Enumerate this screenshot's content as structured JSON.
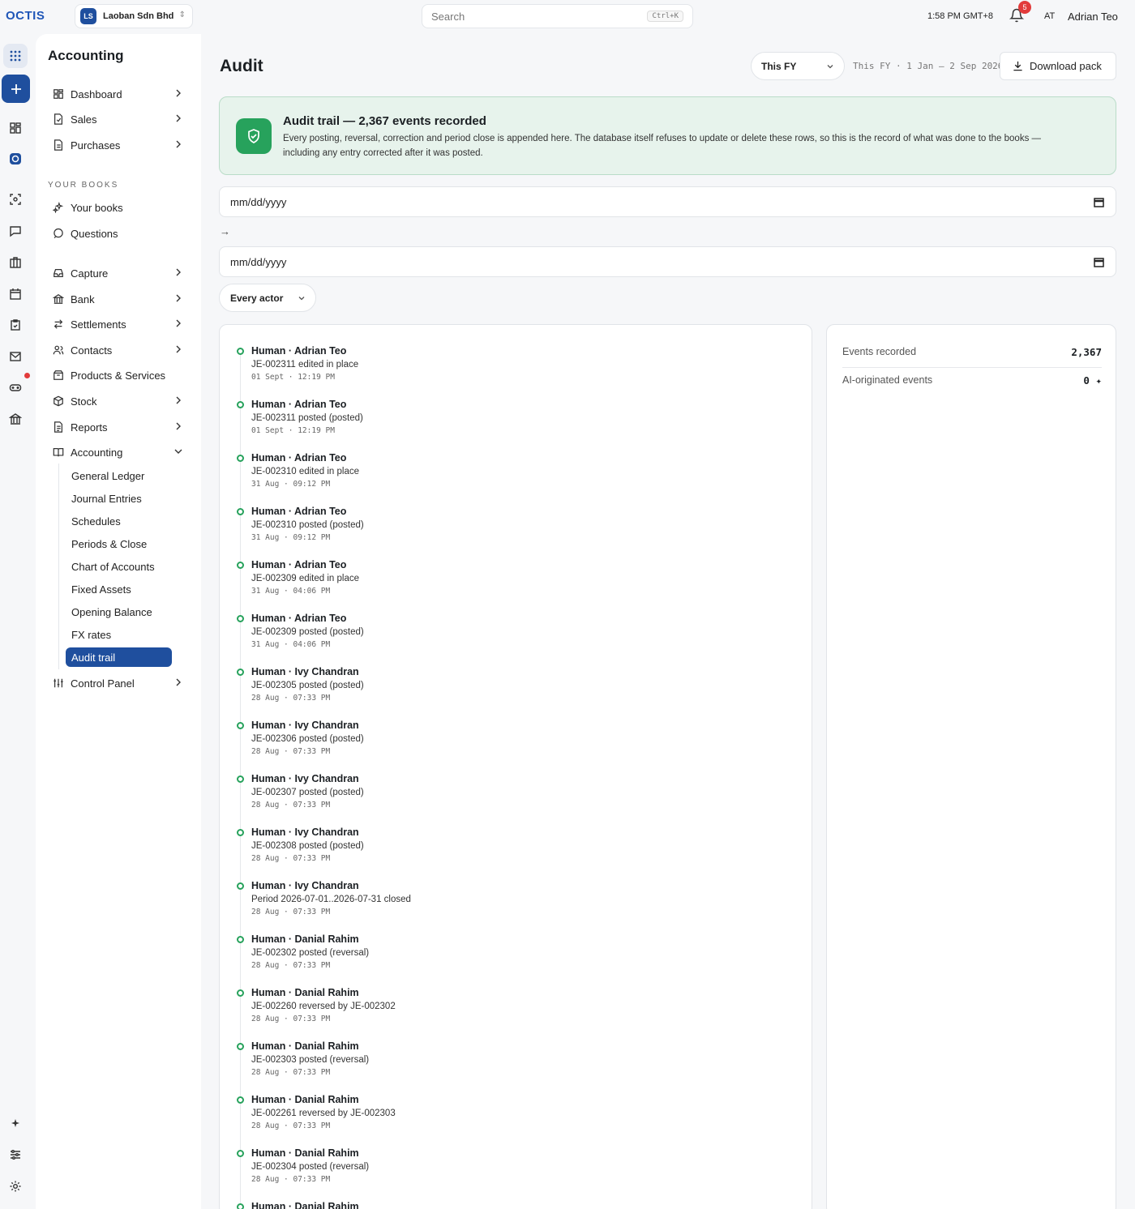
{
  "app": {
    "logo_text": "OCTIS",
    "org": {
      "initials": "LS",
      "name": "Laoban Sdn Bhd"
    },
    "search": {
      "placeholder": "Search",
      "shortcut": "Ctrl+K"
    },
    "clock": "1:58 PM GMT+8",
    "notifications_count": "5",
    "user": {
      "initials": "AT",
      "name": "Adrian Teo"
    }
  },
  "sidebar": {
    "title": "Accounting",
    "top_items": [
      {
        "label": "Dashboard",
        "icon": "dashboard-icon"
      },
      {
        "label": "Sales",
        "icon": "sales-icon"
      },
      {
        "label": "Purchases",
        "icon": "purchases-icon"
      }
    ],
    "section_label": "YOUR BOOKS",
    "books_items": [
      {
        "label": "Your books",
        "icon": "sparkle-icon"
      },
      {
        "label": "Questions",
        "icon": "chat-icon"
      }
    ],
    "main_items": [
      {
        "label": "Capture",
        "icon": "inbox-icon"
      },
      {
        "label": "Bank",
        "icon": "bank-icon"
      },
      {
        "label": "Settlements",
        "icon": "swap-icon"
      },
      {
        "label": "Contacts",
        "icon": "contacts-icon"
      },
      {
        "label": "Products & Services",
        "icon": "package-icon"
      },
      {
        "label": "Stock",
        "icon": "box-icon"
      },
      {
        "label": "Reports",
        "icon": "report-icon"
      },
      {
        "label": "Accounting",
        "icon": "book-icon"
      }
    ],
    "accounting_sub": [
      "General Ledger",
      "Journal Entries",
      "Schedules",
      "Periods & Close",
      "Chart of Accounts",
      "Fixed Assets",
      "Opening Balance",
      "FX rates",
      "Audit trail"
    ],
    "active_sub": "Audit trail",
    "control_panel": "Control Panel"
  },
  "page": {
    "title": "Audit",
    "period_select": "This FY",
    "period_range": "This FY · 1 Jan – 2 Sep 2026",
    "download_label": "Download pack",
    "banner_title": "Audit trail — 2,367 events recorded",
    "banner_body": "Every posting, reversal, correction and period close is appended here. The database itself refuses to update or delete these rows, so this is the record of what was done to the books — including any entry corrected after it was posted.",
    "date_from_placeholder": "mm/dd/yyyy",
    "date_to_placeholder": "mm/dd/yyyy",
    "range_arrow": "→",
    "actor_filter": "Every actor"
  },
  "events": [
    {
      "actor": "Human · Adrian Teo",
      "action": "JE-002311 edited in place",
      "time": "01 Sept · 12:19 PM"
    },
    {
      "actor": "Human · Adrian Teo",
      "action": "JE-002311 posted (posted)",
      "time": "01 Sept · 12:19 PM"
    },
    {
      "actor": "Human · Adrian Teo",
      "action": "JE-002310 edited in place",
      "time": "31 Aug · 09:12 PM"
    },
    {
      "actor": "Human · Adrian Teo",
      "action": "JE-002310 posted (posted)",
      "time": "31 Aug · 09:12 PM"
    },
    {
      "actor": "Human · Adrian Teo",
      "action": "JE-002309 edited in place",
      "time": "31 Aug · 04:06 PM"
    },
    {
      "actor": "Human · Adrian Teo",
      "action": "JE-002309 posted (posted)",
      "time": "31 Aug · 04:06 PM"
    },
    {
      "actor": "Human · Ivy Chandran",
      "action": "JE-002305 posted (posted)",
      "time": "28 Aug · 07:33 PM"
    },
    {
      "actor": "Human · Ivy Chandran",
      "action": "JE-002306 posted (posted)",
      "time": "28 Aug · 07:33 PM"
    },
    {
      "actor": "Human · Ivy Chandran",
      "action": "JE-002307 posted (posted)",
      "time": "28 Aug · 07:33 PM"
    },
    {
      "actor": "Human · Ivy Chandran",
      "action": "JE-002308 posted (posted)",
      "time": "28 Aug · 07:33 PM"
    },
    {
      "actor": "Human · Ivy Chandran",
      "action": "Period 2026-07-01..2026-07-31 closed",
      "time": "28 Aug · 07:33 PM"
    },
    {
      "actor": "Human · Danial Rahim",
      "action": "JE-002302 posted (reversal)",
      "time": "28 Aug · 07:33 PM"
    },
    {
      "actor": "Human · Danial Rahim",
      "action": "JE-002260 reversed by JE-002302",
      "time": "28 Aug · 07:33 PM"
    },
    {
      "actor": "Human · Danial Rahim",
      "action": "JE-002303 posted (reversal)",
      "time": "28 Aug · 07:33 PM"
    },
    {
      "actor": "Human · Danial Rahim",
      "action": "JE-002261 reversed by JE-002303",
      "time": "28 Aug · 07:33 PM"
    },
    {
      "actor": "Human · Danial Rahim",
      "action": "JE-002304 posted (reversal)",
      "time": "28 Aug · 07:33 PM"
    },
    {
      "actor": "Human · Danial Rahim",
      "action": "",
      "time": ""
    }
  ],
  "stats": [
    {
      "label": "Events recorded",
      "value": "2,367"
    },
    {
      "label": "AI-originated events",
      "value": "0 ✦"
    }
  ],
  "colors": {
    "accent": "#1f4f9e",
    "success": "#27a25c",
    "banner_bg": "#e7f3ec",
    "alert": "#e23b3b"
  }
}
